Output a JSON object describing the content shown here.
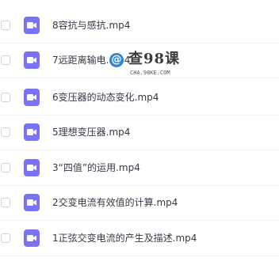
{
  "files": [
    {
      "name": "8容抗与感抗.mp4",
      "icon": "video-file-icon"
    },
    {
      "name": "7远距离输电.mp4",
      "icon": "video-file-icon"
    },
    {
      "name": "6变压器的动态变化.mp4",
      "icon": "video-file-icon"
    },
    {
      "name": "5理想变压器.mp4",
      "icon": "video-file-icon"
    },
    {
      "name": "3“四值”的运用.mp4",
      "icon": "video-file-icon"
    },
    {
      "name": "2交变电流有效值的计算.mp4",
      "icon": "video-file-icon"
    },
    {
      "name": "1正弦交变电流的产生及描述.mp4",
      "icon": "video-file-icon"
    }
  ],
  "watermark": {
    "symbol": "@",
    "text": "查98课",
    "domain": "CHA.98KE.COM"
  },
  "colors": {
    "icon_bg": "#7a74f5",
    "text": "#333a45",
    "divider": "#f0f1f4",
    "watermark_badge": "#2f86d6"
  }
}
